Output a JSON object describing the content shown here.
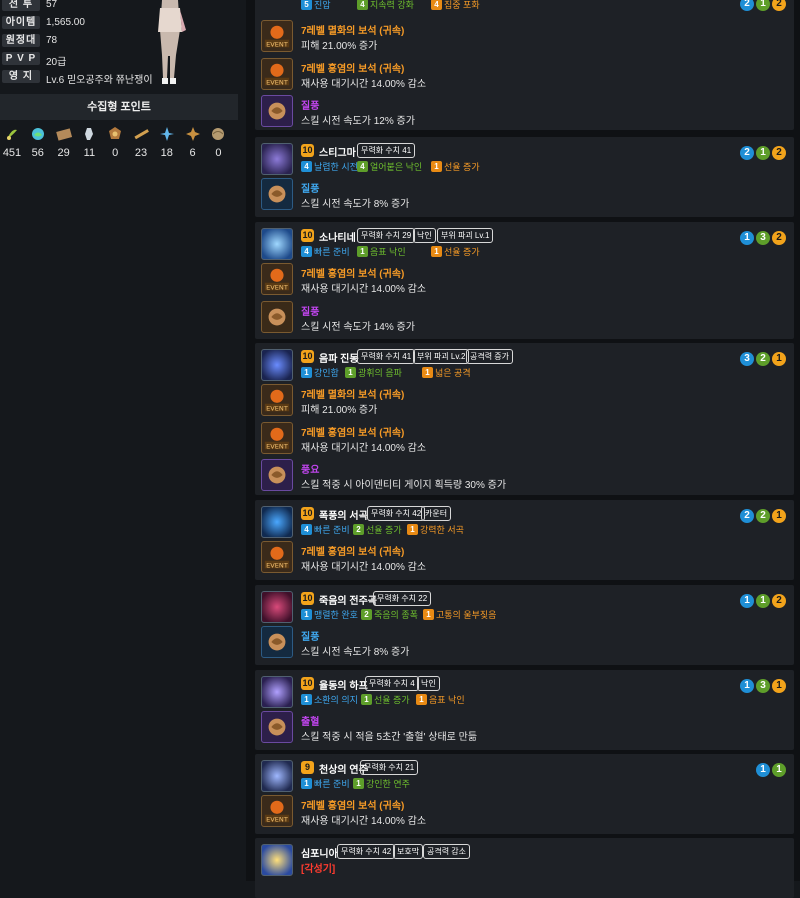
{
  "profile": {
    "stats": [
      {
        "label": "전 투",
        "value": "57"
      },
      {
        "label": "아이템",
        "value": "1,565.00"
      },
      {
        "label": "원정대",
        "value": "78"
      },
      {
        "label": "P V P",
        "value": "20급"
      },
      {
        "label": "영 지",
        "value": "Lv.6 믿오공주와 쮸난쟁이"
      }
    ]
  },
  "collection": {
    "title": "수집형 포인트",
    "items": [
      {
        "icon": "mokoko-seed-icon",
        "count": "451"
      },
      {
        "icon": "island-heart-icon",
        "count": "56"
      },
      {
        "icon": "great-art-icon",
        "count": "29"
      },
      {
        "icon": "giant-heart-icon",
        "count": "11"
      },
      {
        "icon": "ignea-token-icon",
        "count": "0"
      },
      {
        "icon": "adventure-tome-icon",
        "count": "23"
      },
      {
        "icon": "world-tree-leaf-icon",
        "count": "18"
      },
      {
        "icon": "voyage-icon",
        "count": "6"
      },
      {
        "icon": "orpheus-star-icon",
        "count": "0"
      }
    ]
  },
  "cards": [
    {
      "name": "",
      "level": "",
      "tags": [],
      "tripods": [
        {
          "n": "5",
          "text": "진압",
          "color": "blue"
        },
        {
          "n": "4",
          "text": "지속력 강화",
          "color": "green"
        },
        {
          "n": "4",
          "text": "집중 포화",
          "color": "orange"
        }
      ],
      "circles": [
        "2",
        "1",
        "2"
      ],
      "gems": [
        {
          "type": "event",
          "title": "7레벨 멸화의 보석 (귀속)",
          "color": "orange",
          "desc": "피해 21.00% 증가"
        },
        {
          "type": "event",
          "title": "7레벨 홍염의 보석 (귀속)",
          "color": "orange",
          "desc": "재사용 대기시간 14.00% 감소"
        },
        {
          "type": "rune-purple",
          "title": "질풍",
          "color": "purple",
          "desc": "스킬 시전 속도가 12% 증가"
        }
      ]
    },
    {
      "name": "스티그마",
      "level": "10",
      "tags": [
        "무력화 수치 41"
      ],
      "tripods": [
        {
          "n": "4",
          "text": "날렵한 시전",
          "color": "blue"
        },
        {
          "n": "4",
          "text": "얼어붙은 낙인",
          "color": "green"
        },
        {
          "n": "1",
          "text": "선율 증가",
          "color": "orange"
        }
      ],
      "circles": [
        "2",
        "1",
        "2"
      ],
      "gems": [
        {
          "type": "rune-blue",
          "title": "질풍",
          "color": "blue",
          "desc": "스킬 시전 속도가 8% 증가"
        }
      ]
    },
    {
      "name": "소나티네",
      "level": "10",
      "tags": [
        "무력화 수치 29",
        "낙인",
        "부위 파괴 Lv.1"
      ],
      "tripods": [
        {
          "n": "4",
          "text": "빠른 준비",
          "color": "blue"
        },
        {
          "n": "1",
          "text": "음표 낙인",
          "color": "green"
        },
        {
          "n": "1",
          "text": "선율 증가",
          "color": "orange"
        }
      ],
      "circles": [
        "1",
        "3",
        "2"
      ],
      "gems": [
        {
          "type": "event",
          "title": "7레벨 홍염의 보석 (귀속)",
          "color": "orange",
          "desc": "재사용 대기시간 14.00% 감소"
        },
        {
          "type": "rune-brown",
          "title": "질풍",
          "color": "purple",
          "desc": "스킬 시전 속도가 14% 증가"
        }
      ]
    },
    {
      "name": "음파 진동",
      "level": "10",
      "tags": [
        "무력화 수치 41",
        "부위 파괴 Lv.2",
        "공격력 증가"
      ],
      "tripods": [
        {
          "n": "1",
          "text": "강인함",
          "color": "blue"
        },
        {
          "n": "1",
          "text": "광휘의 음파",
          "color": "green"
        },
        {
          "n": "1",
          "text": "넓은 공격",
          "color": "orange"
        }
      ],
      "circles": [
        "3",
        "2",
        "1"
      ],
      "gems": [
        {
          "type": "event",
          "title": "7레벨 멸화의 보석 (귀속)",
          "color": "orange",
          "desc": "피해 21.00% 증가"
        },
        {
          "type": "event",
          "title": "7레벨 홍염의 보석 (귀속)",
          "color": "orange",
          "desc": "재사용 대기시간 14.00% 감소"
        },
        {
          "type": "rune-purple",
          "title": "풍요",
          "color": "purple",
          "desc": "스킬 적중 시 아이덴티티 게이지 획득량 30% 증가"
        }
      ]
    },
    {
      "name": "폭풍의 서곡",
      "level": "10",
      "tags": [
        "무력화 수치 42",
        "카운터"
      ],
      "tripods": [
        {
          "n": "4",
          "text": "빠른 준비",
          "color": "blue"
        },
        {
          "n": "2",
          "text": "선율 증가",
          "color": "green"
        },
        {
          "n": "1",
          "text": "강력한 서곡",
          "color": "orange"
        }
      ],
      "circles": [
        "2",
        "2",
        "1"
      ],
      "gems": [
        {
          "type": "event",
          "title": "7레벨 홍염의 보석 (귀속)",
          "color": "orange",
          "desc": "재사용 대기시간 14.00% 감소"
        }
      ]
    },
    {
      "name": "죽음의 전주곡",
      "level": "10",
      "tags": [
        "무력화 수치 22"
      ],
      "tripods": [
        {
          "n": "1",
          "text": "맹렬한 완호",
          "color": "blue"
        },
        {
          "n": "2",
          "text": "죽음의 종폭",
          "color": "green"
        },
        {
          "n": "1",
          "text": "고통의 울부짖음",
          "color": "orange"
        }
      ],
      "circles": [
        "1",
        "1",
        "2"
      ],
      "gems": [
        {
          "type": "rune-blue",
          "title": "질풍",
          "color": "blue",
          "desc": "스킬 시전 속도가 8% 증가"
        }
      ]
    },
    {
      "name": "율동의 하프",
      "level": "10",
      "tags": [
        "무력화 수치 4",
        "낙인"
      ],
      "tripods": [
        {
          "n": "1",
          "text": "소환의 의지",
          "color": "blue"
        },
        {
          "n": "1",
          "text": "선율 증가",
          "color": "green"
        },
        {
          "n": "1",
          "text": "음표 낙인",
          "color": "orange"
        }
      ],
      "circles": [
        "1",
        "3",
        "1"
      ],
      "gems": [
        {
          "type": "rune-purple",
          "title": "출혈",
          "color": "purple",
          "desc": "스킬 적중 시 적을 5초간 '출혈' 상태로 만듦"
        }
      ]
    },
    {
      "name": "천상의 연주",
      "level": "9",
      "tags": [
        "무력화 수치 21"
      ],
      "tripods": [
        {
          "n": "1",
          "text": "빠른 준비",
          "color": "blue"
        },
        {
          "n": "1",
          "text": "강인한 연주",
          "color": "green"
        }
      ],
      "circles": [
        "1",
        "1"
      ],
      "gems": [
        {
          "type": "event",
          "title": "7레벨 홍염의 보석 (귀속)",
          "color": "orange",
          "desc": "재사용 대기시간 14.00% 감소"
        }
      ]
    },
    {
      "name": "심포니아",
      "level": "",
      "tags": [
        "무력화 수치 42",
        "보호막",
        "공격력 감소"
      ],
      "awaken": "[각성기]",
      "tripods": [],
      "circles": [],
      "gems": []
    }
  ]
}
